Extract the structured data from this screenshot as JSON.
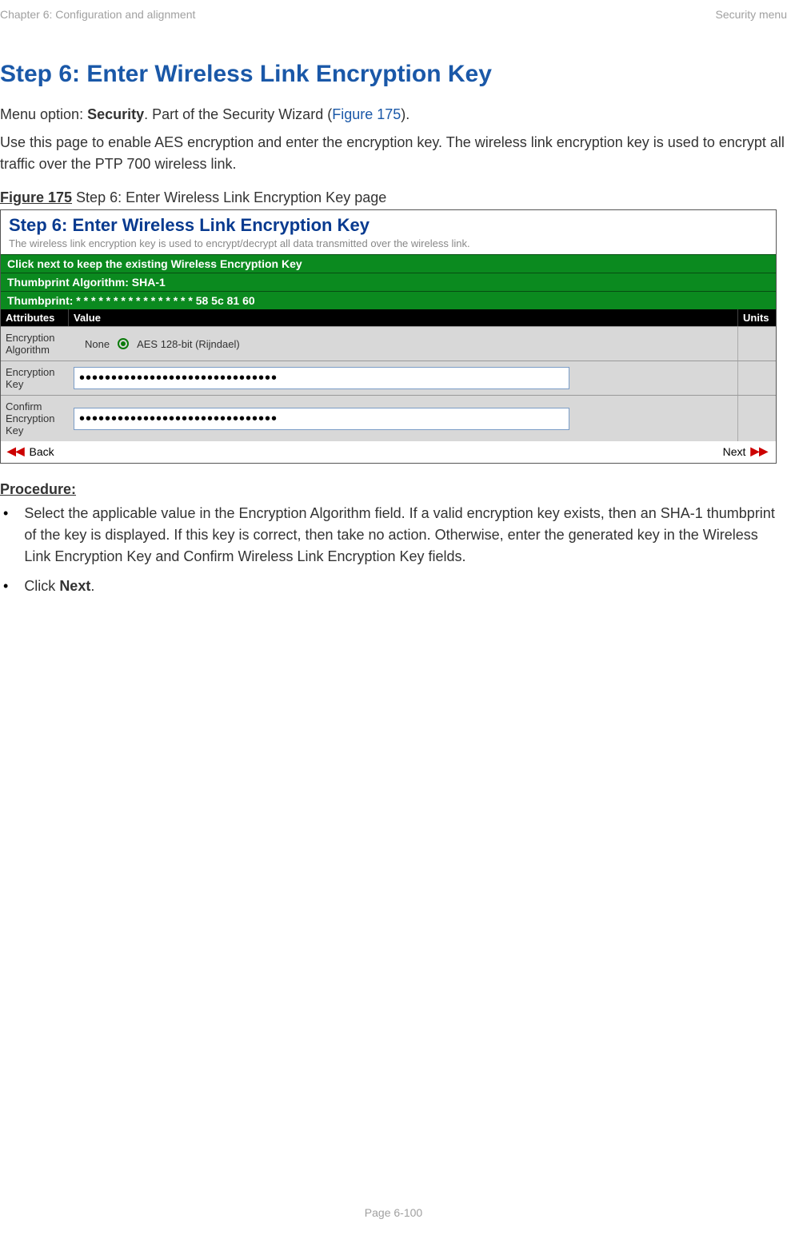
{
  "header": {
    "left": "Chapter 6:  Configuration and alignment",
    "right": "Security menu"
  },
  "heading": "Step 6: Enter Wireless Link Encryption Key",
  "para1": {
    "prefix": "Menu option: ",
    "bold": "Security",
    "mid": ". Part of the Security Wizard (",
    "link": "Figure 175",
    "suffix": ")."
  },
  "para2": "Use this page to enable AES encryption and enter the encryption key. The wireless link encryption key is used to encrypt all traffic over the PTP 700 wireless link.",
  "figure": {
    "label": "Figure 175",
    "caption": "  Step 6: Enter Wireless Link Encryption Key page"
  },
  "screenshot": {
    "title": "Step 6: Enter Wireless Link Encryption Key",
    "subtitle": "The wireless link encryption key is used to encrypt/decrypt all data transmitted over the wireless link.",
    "green1": "Click next to keep the existing Wireless Encryption Key",
    "green2": "Thumbprint Algorithm: SHA-1",
    "green3": "Thumbprint: * * * * * * * * * * * * * * * * 58 5c 81 60",
    "columns": {
      "attr": "Attributes",
      "value": "Value",
      "units": "Units"
    },
    "rows": {
      "algo": {
        "label": "Encryption Algorithm",
        "opt_none": "None",
        "opt_aes": "AES 128-bit (Rijndael)"
      },
      "key": {
        "label": "Encryption Key",
        "value": "•••••••••••••••••••••••••••••••"
      },
      "confirm": {
        "label": "Confirm Encryption Key",
        "value": "•••••••••••••••••••••••••••••••"
      }
    },
    "nav": {
      "back": "Back",
      "next": "Next"
    }
  },
  "procedure": {
    "heading": "Procedure:",
    "item1": "Select the applicable value in the Encryption Algorithm field. If a valid encryption key exists, then an SHA-1 thumbprint of the key is displayed. If this key is correct, then take no action. Otherwise, enter the generated key in the Wireless Link Encryption Key and Confirm Wireless Link Encryption Key fields.",
    "item2_prefix": "Click ",
    "item2_bold": "Next",
    "item2_suffix": "."
  },
  "footer": "Page 6-100"
}
